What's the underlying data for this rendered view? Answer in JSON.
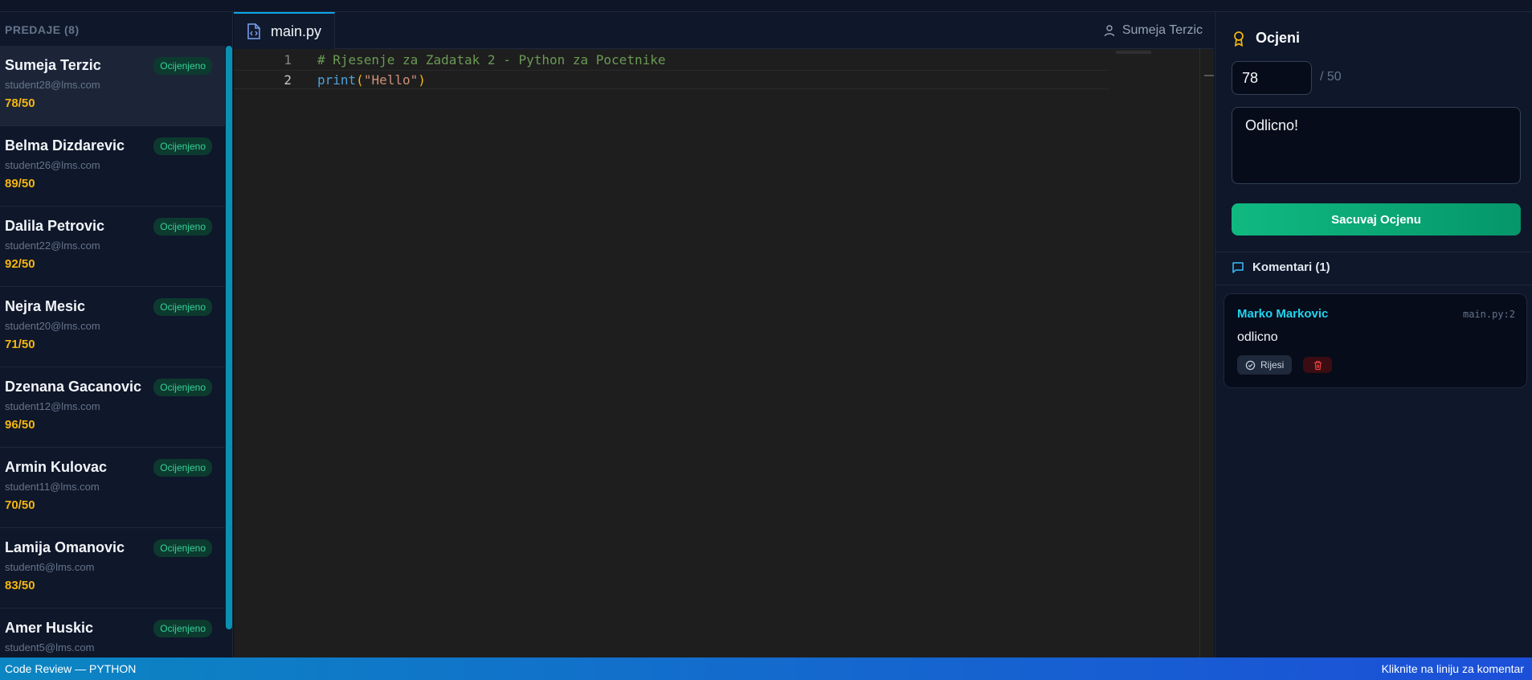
{
  "sidebar": {
    "header": "PREDAJE (8)",
    "submissions": [
      {
        "name": "Sumeja Terzic",
        "email": "student28@lms.com",
        "score": "78/50",
        "status": "Ocijenjeno"
      },
      {
        "name": "Belma Dizdarevic",
        "email": "student26@lms.com",
        "score": "89/50",
        "status": "Ocijenjeno"
      },
      {
        "name": "Dalila Petrovic",
        "email": "student22@lms.com",
        "score": "92/50",
        "status": "Ocijenjeno"
      },
      {
        "name": "Nejra Mesic",
        "email": "student20@lms.com",
        "score": "71/50",
        "status": "Ocijenjeno"
      },
      {
        "name": "Dzenana Gacanovic",
        "email": "student12@lms.com",
        "score": "96/50",
        "status": "Ocijenjeno"
      },
      {
        "name": "Armin Kulovac",
        "email": "student11@lms.com",
        "score": "70/50",
        "status": "Ocijenjeno"
      },
      {
        "name": "Lamija Omanovic",
        "email": "student6@lms.com",
        "score": "83/50",
        "status": "Ocijenjeno"
      },
      {
        "name": "Amer Huskic",
        "email": "student5@lms.com",
        "score": "",
        "status": "Ocijenjeno"
      }
    ]
  },
  "editor": {
    "tab_label": "main.py",
    "owner": "Sumeja Terzic",
    "lines": [
      {
        "number": "1",
        "comment": "# Rjesenje za Zadatak 2 - Python za Pocetnike"
      },
      {
        "number": "2",
        "fn": "print",
        "open": "(",
        "str": "\"Hello\"",
        "close": ")"
      }
    ]
  },
  "grading": {
    "title": "Ocjeni",
    "score_value": "78",
    "max_label": "/ 50",
    "feedback": "Odlicno!",
    "save_label": "Sacuvaj Ocjenu"
  },
  "comments": {
    "title": "Komentari (1)",
    "items": [
      {
        "author": "Marko Markovic",
        "location": "main.py:2",
        "text": "odlicno",
        "resolve_label": "Rijesi"
      }
    ]
  },
  "statusbar": {
    "left": "Code Review — PYTHON",
    "right": "Kliknite na liniju za komentar"
  },
  "icons": {
    "tab": "python-file-icon",
    "owner": "user-icon",
    "grade": "award-icon",
    "comments": "message-square-icon",
    "resolve": "check-circle-icon",
    "delete": "trash-icon"
  },
  "colors": {
    "accent_green": "#10b981",
    "score_yellow": "#f5b70f",
    "author_cyan": "#22d3ee",
    "status_bar": "#0b86c2"
  }
}
